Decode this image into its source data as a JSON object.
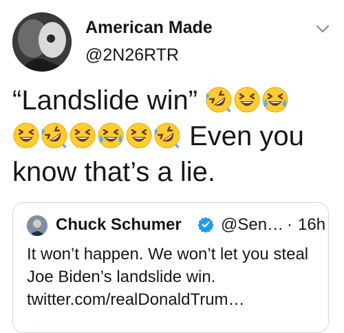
{
  "author": {
    "display_name": "American Made",
    "handle": "@2N26RTR",
    "avatar_icon": "profile-photo"
  },
  "tweet": {
    "text_start": "“Landslide win”",
    "text_end_line2": " Even you",
    "text_line3": "know that’s a lie.",
    "emojis": [
      "rofl",
      "grinning-squinting",
      "joy",
      "grinning-squinting",
      "rofl",
      "grinning-squinting",
      "joy",
      "grinning-squinting",
      "rofl"
    ]
  },
  "quoted_tweet": {
    "display_name": "Chuck Schumer",
    "verified": true,
    "handle": "@Sen…",
    "separator": "·",
    "time": "16h",
    "text": "It won’t happen. We won’t let you steal Joe Biden’s landslide win. twitter.com/realDonaldTrum…"
  },
  "colors": {
    "text": "#14171a",
    "verified_blue": "#1d9bf0",
    "emoji_yellow": "#ffcc33",
    "tear_blue": "#5dadec",
    "border": "#cfd9de"
  },
  "icons": {
    "menu": "chevron-down-icon",
    "verified": "verified-badge-icon"
  }
}
